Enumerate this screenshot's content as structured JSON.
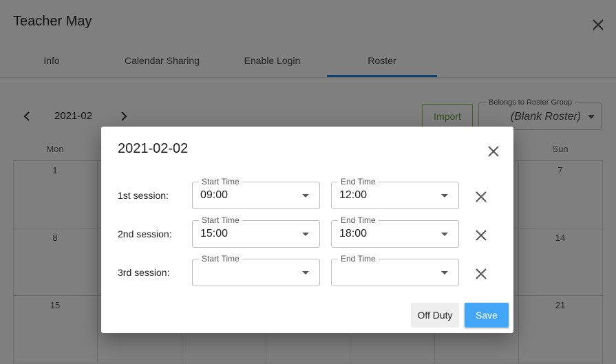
{
  "header": {
    "title": "Teacher May"
  },
  "tabs": [
    {
      "label": "Info"
    },
    {
      "label": "Calendar Sharing"
    },
    {
      "label": "Enable Login"
    },
    {
      "label": "Roster",
      "active": true
    }
  ],
  "calendar": {
    "month": "2021-02",
    "import_label": "Import",
    "roster_group": {
      "label": "Belongs to Roster Group",
      "value": "(Blank Roster)"
    },
    "weekdays": [
      "Mon",
      "Sun"
    ],
    "days": {
      "mon": [
        "1",
        "8",
        "15"
      ],
      "sun": [
        "7",
        "14",
        "21"
      ]
    }
  },
  "dialog": {
    "title": "2021-02-02",
    "sessions": [
      {
        "label": "1st session:",
        "start_label": "Start Time",
        "start": "09:00",
        "end_label": "End Time",
        "end": "12:00"
      },
      {
        "label": "2nd session:",
        "start_label": "Start Time",
        "start": "15:00",
        "end_label": "End Time",
        "end": "18:00"
      },
      {
        "label": "3rd session:",
        "start_label": "Start Time",
        "start": "",
        "end_label": "End Time",
        "end": ""
      }
    ],
    "off_duty_label": "Off Duty",
    "save_label": "Save"
  },
  "colors": {
    "accent": "#1e88e5",
    "save": "#42a5f5",
    "import": "#8bc34a"
  },
  "icons": {
    "close": "close-icon",
    "prev": "chevron-left-icon",
    "next": "chevron-right-icon",
    "dropdown": "caret-down-icon"
  }
}
